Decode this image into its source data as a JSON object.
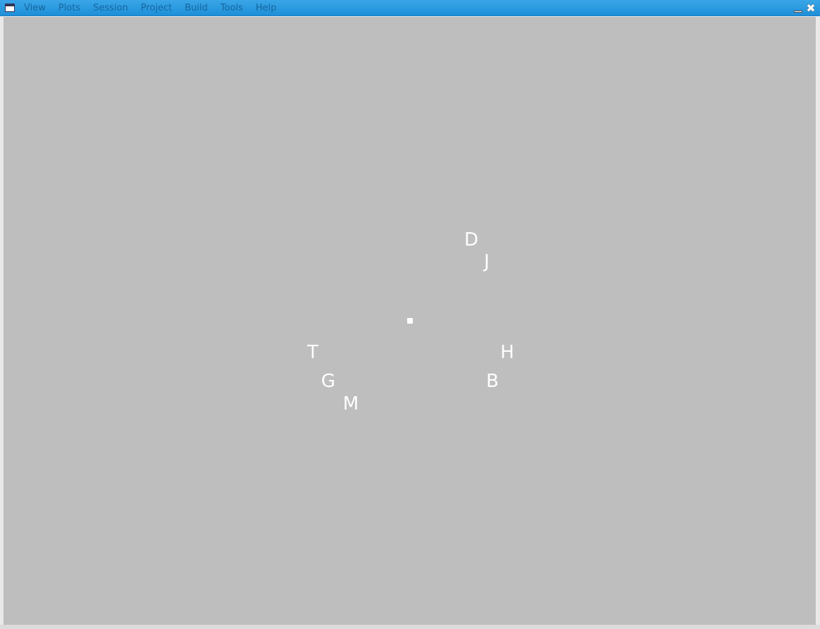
{
  "titlebar": {
    "menu": [
      "View",
      "Plots",
      "Session",
      "Project",
      "Build",
      "Tools",
      "Help"
    ]
  },
  "window_controls": {
    "minimize_icon": "minimize-icon",
    "close_icon": "close-icon",
    "close_glyph": "✖"
  },
  "plot": {
    "background_color": "#bebebe",
    "text_color": "#ffffff",
    "labels": [
      "D",
      "J",
      "T",
      "H",
      "G",
      "B",
      "M"
    ]
  }
}
